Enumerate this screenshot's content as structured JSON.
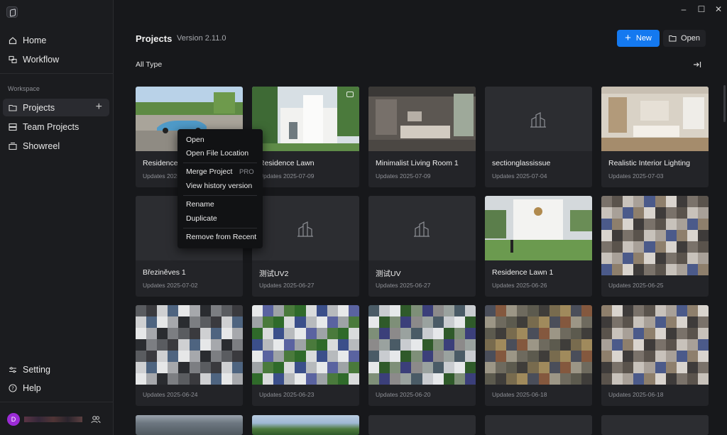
{
  "window": {
    "minimize": "–",
    "maximize": "☐",
    "close": "✕"
  },
  "sidebar": {
    "nav_top": [
      {
        "label": "Home",
        "icon": "home-icon"
      },
      {
        "label": "Workflow",
        "icon": "workflow-icon"
      }
    ],
    "section_label": "Workspace",
    "nav_workspace": [
      {
        "label": "Projects",
        "icon": "projects-icon",
        "active": true
      },
      {
        "label": "Team Projects",
        "icon": "team-projects-icon"
      },
      {
        "label": "Showreel",
        "icon": "showreel-icon"
      }
    ],
    "nav_bottom": [
      {
        "label": "Setting",
        "icon": "sliders-icon"
      },
      {
        "label": "Help",
        "icon": "help-icon"
      }
    ],
    "user": {
      "avatar_letter": "D",
      "avatar_color": "#9b2bd6"
    }
  },
  "header": {
    "title": "Projects",
    "version": "Version 2.11.0",
    "new_label": "New",
    "open_label": "Open",
    "filter_label": "All Type"
  },
  "colors": {
    "accent": "#1479f0",
    "background": "#17181b",
    "card": "#232428"
  },
  "projects": [
    {
      "name": "Residence",
      "date": "Updates 2025-07-09",
      "thumb": "photo-car"
    },
    {
      "name": "Residence Lawn",
      "date": "Updates 2025-07-09",
      "thumb": "photo-house"
    },
    {
      "name": "Minimalist Living Room 1",
      "date": "Updates 2025-07-09",
      "thumb": "photo-living"
    },
    {
      "name": "sectionglassissue",
      "date": "Updates 2025-07-04",
      "thumb": "placeholder"
    },
    {
      "name": "Realistic Interior Lighting",
      "date": "Updates 2025-07-03",
      "thumb": "photo-interior"
    },
    {
      "name": "Březiněves 1",
      "date": "Updates 2025-07-02",
      "thumb": "blank"
    },
    {
      "name": "测试UV2",
      "date": "Updates 2025-06-27",
      "thumb": "placeholder"
    },
    {
      "name": "测试UV",
      "date": "Updates 2025-06-27",
      "thumb": "placeholder"
    },
    {
      "name": "Residence Lawn 1",
      "date": "Updates 2025-06-26",
      "thumb": "photo-lawn"
    },
    {
      "name": "",
      "date": "Updates 2025-06-25",
      "thumb": "pixelated"
    },
    {
      "name": "",
      "date": "Updates 2025-06-24",
      "thumb": "pixelated"
    },
    {
      "name": "",
      "date": "Updates 2025-06-23",
      "thumb": "pixelated"
    },
    {
      "name": "",
      "date": "Updates 2025-06-20",
      "thumb": "pixelated"
    },
    {
      "name": "",
      "date": "Updates 2025-06-18",
      "thumb": "pixelated"
    },
    {
      "name": "",
      "date": "Updates 2025-06-18",
      "thumb": "pixelated"
    }
  ],
  "context_menu": {
    "items": [
      "Open",
      "Open File Location",
      "Merge Project",
      "View history version",
      "Rename",
      "Duplicate",
      "Remove from Recent"
    ],
    "pro_badge": "PRO"
  }
}
